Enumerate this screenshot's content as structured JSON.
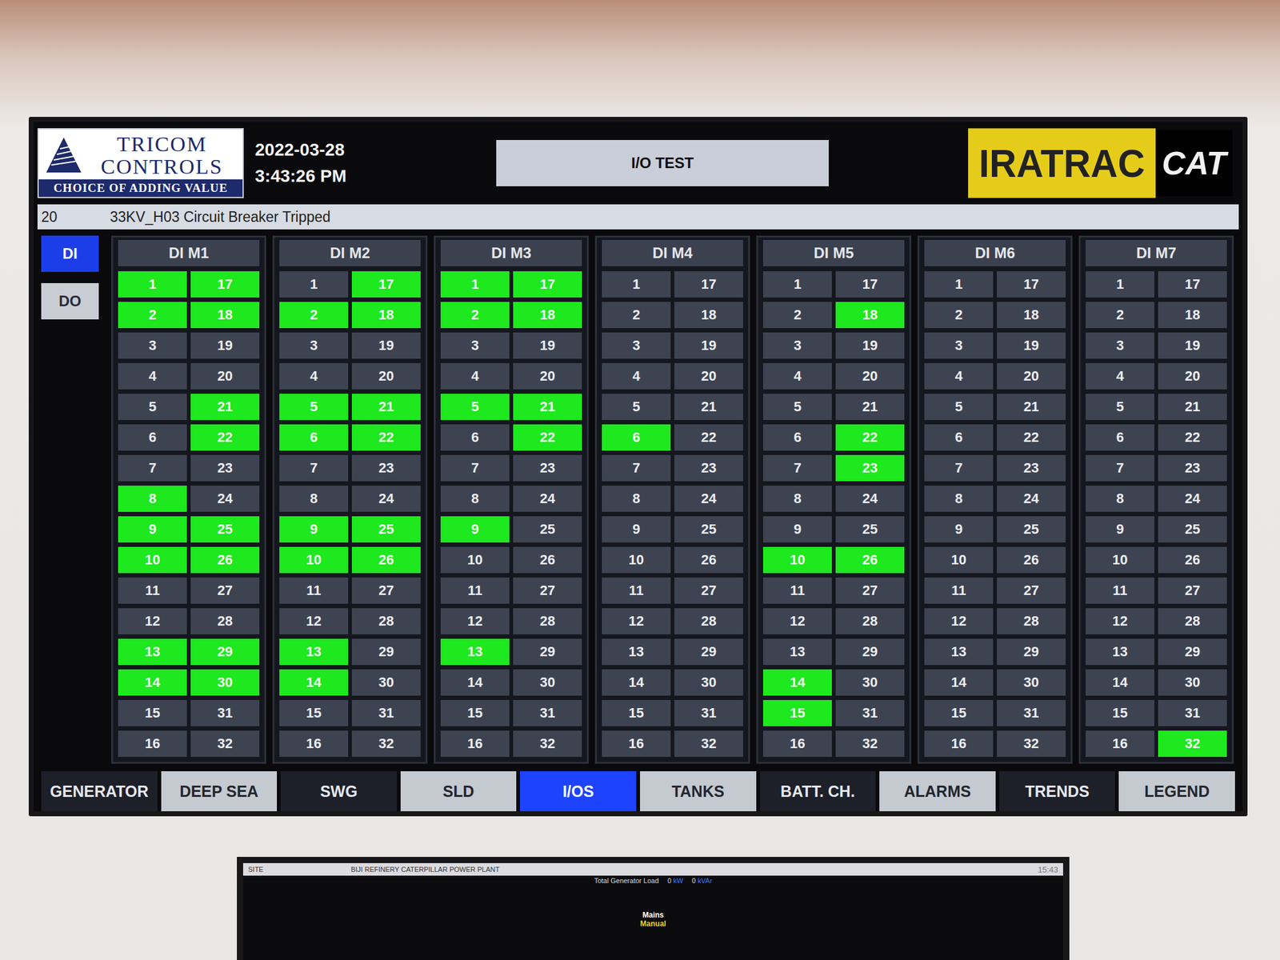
{
  "header": {
    "logo": {
      "line1": "TRICOM",
      "line2": "CONTROLS",
      "tagline": "CHOICE OF ADDING VALUE"
    },
    "date": "2022-03-28",
    "time": "3:43:26 PM",
    "title": "I/O TEST",
    "brand": "IRATRAC",
    "cat": "CAT"
  },
  "alarm": {
    "number": "20",
    "message": "33KV_H03 Circuit Breaker Tripped"
  },
  "sidebar": [
    {
      "label": "DI",
      "selected": true
    },
    {
      "label": "DO",
      "selected": false
    }
  ],
  "modules": [
    {
      "title": "DI M1",
      "inputs": [
        {
          "label": "1",
          "on": true
        },
        {
          "label": "2",
          "on": true
        },
        {
          "label": "3",
          "on": false
        },
        {
          "label": "4",
          "on": false
        },
        {
          "label": "5",
          "on": false
        },
        {
          "label": "6",
          "on": false
        },
        {
          "label": "7",
          "on": false
        },
        {
          "label": "8",
          "on": true
        },
        {
          "label": "9",
          "on": true
        },
        {
          "label": "10",
          "on": true
        },
        {
          "label": "11",
          "on": false
        },
        {
          "label": "12",
          "on": false
        },
        {
          "label": "13",
          "on": true
        },
        {
          "label": "14",
          "on": true
        },
        {
          "label": "15",
          "on": false
        },
        {
          "label": "16",
          "on": false
        },
        {
          "label": "17",
          "on": true
        },
        {
          "label": "18",
          "on": true
        },
        {
          "label": "19",
          "on": false
        },
        {
          "label": "20",
          "on": false
        },
        {
          "label": "21",
          "on": true
        },
        {
          "label": "22",
          "on": true
        },
        {
          "label": "23",
          "on": false
        },
        {
          "label": "24",
          "on": false
        },
        {
          "label": "25",
          "on": true
        },
        {
          "label": "26",
          "on": true
        },
        {
          "label": "27",
          "on": false
        },
        {
          "label": "28",
          "on": false
        },
        {
          "label": "29",
          "on": true
        },
        {
          "label": "30",
          "on": true
        },
        {
          "label": "31",
          "on": false
        },
        {
          "label": "32",
          "on": false
        }
      ]
    },
    {
      "title": "DI M2",
      "inputs": [
        {
          "label": "1",
          "on": false
        },
        {
          "label": "2",
          "on": true
        },
        {
          "label": "3",
          "on": false
        },
        {
          "label": "4",
          "on": false
        },
        {
          "label": "5",
          "on": true
        },
        {
          "label": "6",
          "on": true
        },
        {
          "label": "7",
          "on": false
        },
        {
          "label": "8",
          "on": false
        },
        {
          "label": "9",
          "on": true
        },
        {
          "label": "10",
          "on": true
        },
        {
          "label": "11",
          "on": false
        },
        {
          "label": "12",
          "on": false
        },
        {
          "label": "13",
          "on": true
        },
        {
          "label": "14",
          "on": true
        },
        {
          "label": "15",
          "on": false
        },
        {
          "label": "16",
          "on": false
        },
        {
          "label": "17",
          "on": true
        },
        {
          "label": "18",
          "on": true
        },
        {
          "label": "19",
          "on": false
        },
        {
          "label": "20",
          "on": false
        },
        {
          "label": "21",
          "on": true
        },
        {
          "label": "22",
          "on": true
        },
        {
          "label": "23",
          "on": false
        },
        {
          "label": "24",
          "on": false
        },
        {
          "label": "25",
          "on": true
        },
        {
          "label": "26",
          "on": true
        },
        {
          "label": "27",
          "on": false
        },
        {
          "label": "28",
          "on": false
        },
        {
          "label": "29",
          "on": false
        },
        {
          "label": "30",
          "on": false
        },
        {
          "label": "31",
          "on": false
        },
        {
          "label": "32",
          "on": false
        }
      ]
    },
    {
      "title": "DI M3",
      "inputs": [
        {
          "label": "1",
          "on": true
        },
        {
          "label": "2",
          "on": true
        },
        {
          "label": "3",
          "on": false
        },
        {
          "label": "4",
          "on": false
        },
        {
          "label": "5",
          "on": true
        },
        {
          "label": "6",
          "on": false
        },
        {
          "label": "7",
          "on": false
        },
        {
          "label": "8",
          "on": false
        },
        {
          "label": "9",
          "on": true
        },
        {
          "label": "10",
          "on": false
        },
        {
          "label": "11",
          "on": false
        },
        {
          "label": "12",
          "on": false
        },
        {
          "label": "13",
          "on": true
        },
        {
          "label": "14",
          "on": false
        },
        {
          "label": "15",
          "on": false
        },
        {
          "label": "16",
          "on": false
        },
        {
          "label": "17",
          "on": true
        },
        {
          "label": "18",
          "on": true
        },
        {
          "label": "19",
          "on": false
        },
        {
          "label": "20",
          "on": false
        },
        {
          "label": "21",
          "on": true
        },
        {
          "label": "22",
          "on": true
        },
        {
          "label": "23",
          "on": false
        },
        {
          "label": "24",
          "on": false
        },
        {
          "label": "25",
          "on": false
        },
        {
          "label": "26",
          "on": false
        },
        {
          "label": "27",
          "on": false
        },
        {
          "label": "28",
          "on": false
        },
        {
          "label": "29",
          "on": false
        },
        {
          "label": "30",
          "on": false
        },
        {
          "label": "31",
          "on": false
        },
        {
          "label": "32",
          "on": false
        }
      ]
    },
    {
      "title": "DI M4",
      "inputs": [
        {
          "label": "1",
          "on": false
        },
        {
          "label": "2",
          "on": false
        },
        {
          "label": "3",
          "on": false
        },
        {
          "label": "4",
          "on": false
        },
        {
          "label": "5",
          "on": false
        },
        {
          "label": "6",
          "on": true
        },
        {
          "label": "7",
          "on": false
        },
        {
          "label": "8",
          "on": false
        },
        {
          "label": "9",
          "on": false
        },
        {
          "label": "10",
          "on": false
        },
        {
          "label": "11",
          "on": false
        },
        {
          "label": "12",
          "on": false
        },
        {
          "label": "13",
          "on": false
        },
        {
          "label": "14",
          "on": false
        },
        {
          "label": "15",
          "on": false
        },
        {
          "label": "16",
          "on": false
        },
        {
          "label": "17",
          "on": false
        },
        {
          "label": "18",
          "on": false
        },
        {
          "label": "19",
          "on": false
        },
        {
          "label": "20",
          "on": false
        },
        {
          "label": "21",
          "on": false
        },
        {
          "label": "22",
          "on": false
        },
        {
          "label": "23",
          "on": false
        },
        {
          "label": "24",
          "on": false
        },
        {
          "label": "25",
          "on": false
        },
        {
          "label": "26",
          "on": false
        },
        {
          "label": "27",
          "on": false
        },
        {
          "label": "28",
          "on": false
        },
        {
          "label": "29",
          "on": false
        },
        {
          "label": "30",
          "on": false
        },
        {
          "label": "31",
          "on": false
        },
        {
          "label": "32",
          "on": false
        }
      ]
    },
    {
      "title": "DI M5",
      "inputs": [
        {
          "label": "1",
          "on": false
        },
        {
          "label": "2",
          "on": false
        },
        {
          "label": "3",
          "on": false
        },
        {
          "label": "4",
          "on": false
        },
        {
          "label": "5",
          "on": false
        },
        {
          "label": "6",
          "on": false
        },
        {
          "label": "7",
          "on": false
        },
        {
          "label": "8",
          "on": false
        },
        {
          "label": "9",
          "on": false
        },
        {
          "label": "10",
          "on": true
        },
        {
          "label": "11",
          "on": false
        },
        {
          "label": "12",
          "on": false
        },
        {
          "label": "13",
          "on": false
        },
        {
          "label": "14",
          "on": true
        },
        {
          "label": "15",
          "on": true
        },
        {
          "label": "16",
          "on": false
        },
        {
          "label": "17",
          "on": false
        },
        {
          "label": "18",
          "on": true
        },
        {
          "label": "19",
          "on": false
        },
        {
          "label": "20",
          "on": false
        },
        {
          "label": "21",
          "on": false
        },
        {
          "label": "22",
          "on": true
        },
        {
          "label": "23",
          "on": true
        },
        {
          "label": "24",
          "on": false
        },
        {
          "label": "25",
          "on": false
        },
        {
          "label": "26",
          "on": true
        },
        {
          "label": "27",
          "on": false
        },
        {
          "label": "28",
          "on": false
        },
        {
          "label": "29",
          "on": false
        },
        {
          "label": "30",
          "on": false
        },
        {
          "label": "31",
          "on": false
        },
        {
          "label": "32",
          "on": false
        }
      ]
    },
    {
      "title": "DI M6",
      "inputs": [
        {
          "label": "1",
          "on": false
        },
        {
          "label": "2",
          "on": false
        },
        {
          "label": "3",
          "on": false
        },
        {
          "label": "4",
          "on": false
        },
        {
          "label": "5",
          "on": false
        },
        {
          "label": "6",
          "on": false
        },
        {
          "label": "7",
          "on": false
        },
        {
          "label": "8",
          "on": false
        },
        {
          "label": "9",
          "on": false
        },
        {
          "label": "10",
          "on": false
        },
        {
          "label": "11",
          "on": false
        },
        {
          "label": "12",
          "on": false
        },
        {
          "label": "13",
          "on": false
        },
        {
          "label": "14",
          "on": false
        },
        {
          "label": "15",
          "on": false
        },
        {
          "label": "16",
          "on": false
        },
        {
          "label": "17",
          "on": false
        },
        {
          "label": "18",
          "on": false
        },
        {
          "label": "19",
          "on": false
        },
        {
          "label": "20",
          "on": false
        },
        {
          "label": "21",
          "on": false
        },
        {
          "label": "22",
          "on": false
        },
        {
          "label": "23",
          "on": false
        },
        {
          "label": "24",
          "on": false
        },
        {
          "label": "25",
          "on": false
        },
        {
          "label": "26",
          "on": false
        },
        {
          "label": "27",
          "on": false
        },
        {
          "label": "28",
          "on": false
        },
        {
          "label": "29",
          "on": false
        },
        {
          "label": "30",
          "on": false
        },
        {
          "label": "31",
          "on": false
        },
        {
          "label": "32",
          "on": false
        }
      ]
    },
    {
      "title": "DI M7",
      "inputs": [
        {
          "label": "1",
          "on": false
        },
        {
          "label": "2",
          "on": false
        },
        {
          "label": "3",
          "on": false
        },
        {
          "label": "4",
          "on": false
        },
        {
          "label": "5",
          "on": false
        },
        {
          "label": "6",
          "on": false
        },
        {
          "label": "7",
          "on": false
        },
        {
          "label": "8",
          "on": false
        },
        {
          "label": "9",
          "on": false
        },
        {
          "label": "10",
          "on": false
        },
        {
          "label": "11",
          "on": false
        },
        {
          "label": "12",
          "on": false
        },
        {
          "label": "13",
          "on": false
        },
        {
          "label": "14",
          "on": false
        },
        {
          "label": "15",
          "on": false
        },
        {
          "label": "16",
          "on": false
        },
        {
          "label": "17",
          "on": false
        },
        {
          "label": "18",
          "on": false
        },
        {
          "label": "19",
          "on": false
        },
        {
          "label": "20",
          "on": false
        },
        {
          "label": "21",
          "on": false
        },
        {
          "label": "22",
          "on": false
        },
        {
          "label": "23",
          "on": false
        },
        {
          "label": "24",
          "on": false
        },
        {
          "label": "25",
          "on": false
        },
        {
          "label": "26",
          "on": false
        },
        {
          "label": "27",
          "on": false
        },
        {
          "label": "28",
          "on": false
        },
        {
          "label": "29",
          "on": false
        },
        {
          "label": "30",
          "on": false
        },
        {
          "label": "31",
          "on": false
        },
        {
          "label": "32",
          "on": true
        }
      ]
    }
  ],
  "tabs": [
    {
      "label": "GENERATOR",
      "selected": false,
      "kind": "dark"
    },
    {
      "label": "DEEP SEA",
      "selected": false,
      "kind": "light"
    },
    {
      "label": "SWG",
      "selected": false,
      "kind": "dark"
    },
    {
      "label": "SLD",
      "selected": false,
      "kind": "light"
    },
    {
      "label": "I/OS",
      "selected": true,
      "kind": "dark"
    },
    {
      "label": "TANKS",
      "selected": false,
      "kind": "light"
    },
    {
      "label": "BATT. CH.",
      "selected": false,
      "kind": "dark"
    },
    {
      "label": "ALARMS",
      "selected": false,
      "kind": "light"
    },
    {
      "label": "TRENDS",
      "selected": false,
      "kind": "dark"
    },
    {
      "label": "LEGEND",
      "selected": false,
      "kind": "light"
    }
  ],
  "lower_monitor": {
    "site": "SITE",
    "title": "BIJI REFINERY CATERPILLAR POWER PLANT",
    "time": "15:43",
    "load_label": "Total Generator Load",
    "kw_value": "0",
    "kw_unit": "kW",
    "kvar_value": "0",
    "kvar_unit": "kVAr",
    "mode": "Mains",
    "mode_state": "Manual"
  }
}
